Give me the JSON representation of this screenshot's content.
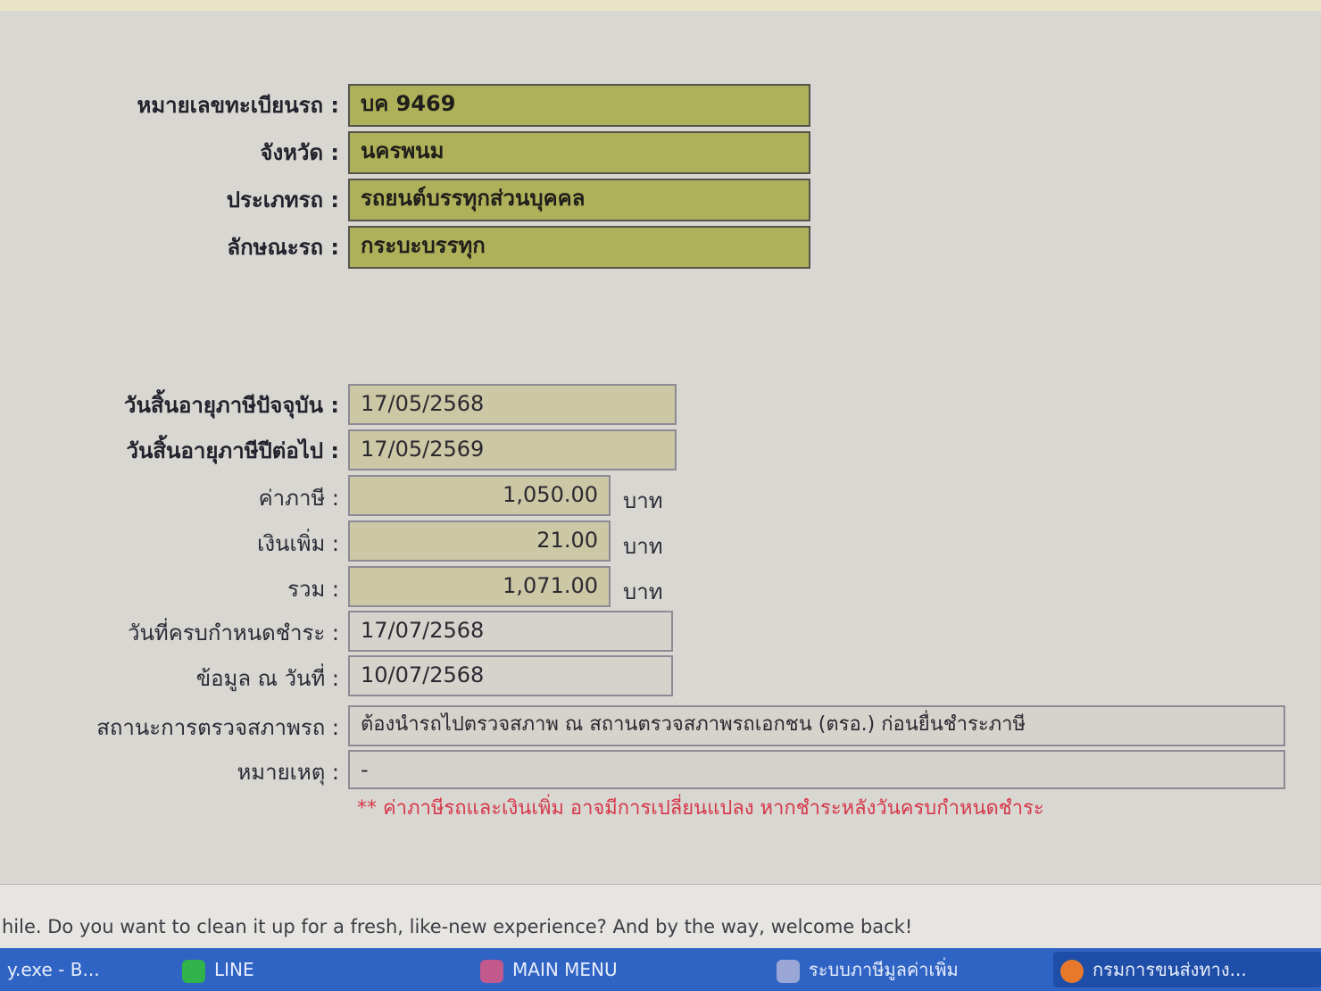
{
  "vehicle": {
    "plate": {
      "label": "หมายเลขทะเบียนรถ :",
      "value": "บค 9469"
    },
    "province": {
      "label": "จังหวัด :",
      "value": "นครพนม"
    },
    "type": {
      "label": "ประเภทรถ :",
      "value": "รถยนต์บรรทุกส่วนบุคคล"
    },
    "body": {
      "label": "ลักษณะรถ :",
      "value": "กระบะบรรทุก"
    }
  },
  "tax": {
    "current_expiry": {
      "label": "วันสิ้นอายุภาษีปัจจุบัน :",
      "value": "17/05/2568"
    },
    "next_expiry": {
      "label": "วันสิ้นอายุภาษีปีต่อไป :",
      "value": "17/05/2569"
    },
    "tax_amount": {
      "label": "ค่าภาษี :",
      "value": "1,050.00",
      "unit": "บาท"
    },
    "surcharge": {
      "label": "เงินเพิ่ม :",
      "value": "21.00",
      "unit": "บาท"
    },
    "total": {
      "label": "รวม :",
      "value": "1,071.00",
      "unit": "บาท"
    },
    "due_date": {
      "label": "วันที่ครบกำหนดชำระ :",
      "value": "17/07/2568"
    },
    "data_date": {
      "label": "ข้อมูล ณ วันที่ :",
      "value": "10/07/2568"
    },
    "inspection": {
      "label": "สถานะการตรวจสภาพรถ :",
      "value": "ต้องนำรถไปตรวจสภาพ ณ สถานตรวจสภาพรถเอกชน (ตรอ.) ก่อนยื่นชำระภาษี"
    },
    "remark": {
      "label": "หมายเหตุ :",
      "value": "-"
    }
  },
  "warning_note": "** ค่าภาษีรถและเงินเพิ่ม อาจมีการเปลี่ยนแปลง หากชำระหลังวันครบกำหนดชำระ",
  "notification": "hile. Do you want to clean it up for a fresh, like-new experience? And by the way, welcome back!",
  "taskbar": {
    "items": [
      {
        "label": "y.exe - B..."
      },
      {
        "label": "LINE"
      },
      {
        "label": "MAIN MENU"
      },
      {
        "label": "ระบบภาษีมูลค่าเพิ่ม"
      },
      {
        "label": "กรมการขนส่งทาง..."
      }
    ]
  },
  "colors": {
    "field_olive": "#aeb05a",
    "field_tan": "#ccc7a5",
    "warning_red": "#d6384a",
    "taskbar_blue": "#2f63c4"
  }
}
